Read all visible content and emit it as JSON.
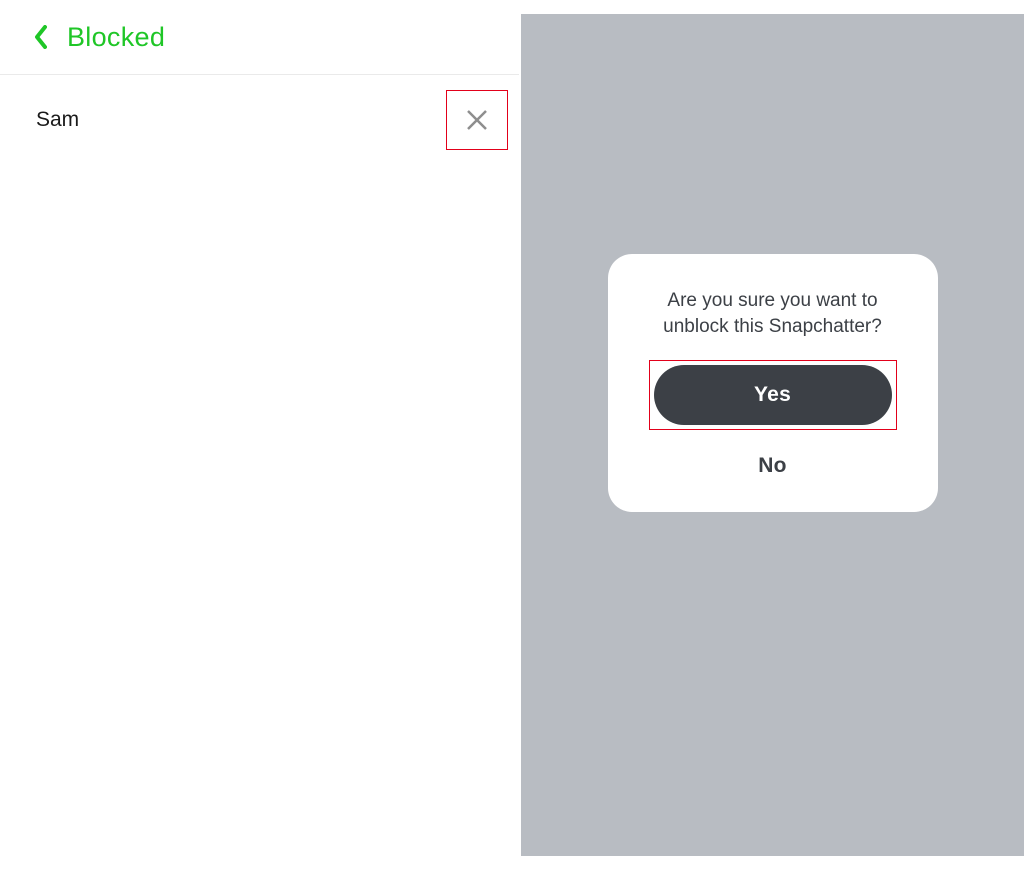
{
  "header": {
    "title": "Blocked"
  },
  "list": {
    "items": [
      {
        "name": "Sam"
      }
    ]
  },
  "modal": {
    "message": "Are you sure you want to unblock this Snapchatter?",
    "yes_label": "Yes",
    "no_label": "No"
  }
}
